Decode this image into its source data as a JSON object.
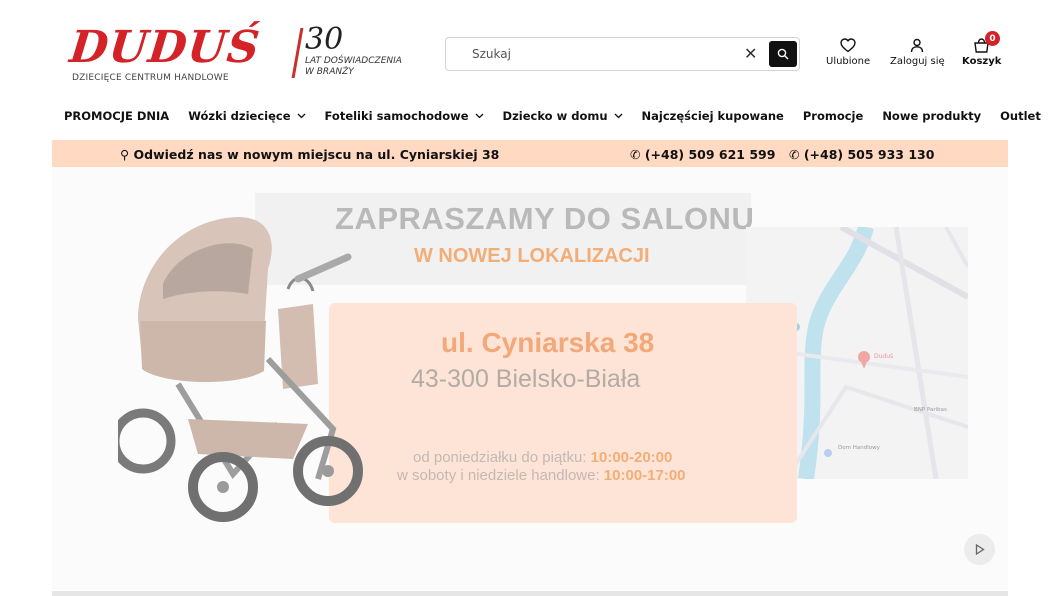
{
  "header": {
    "logo_text": "DUDUŚ",
    "logo_subtitle": "DZIECIĘCE CENTRUM HANDLOWE",
    "years_number": "30",
    "years_text_line1": "LAT DOŚWIADCZENIA",
    "years_text_line2": "W BRANŻY",
    "search_placeholder": "Szukaj",
    "favorites_label": "Ulubione",
    "login_label": "Zaloguj się",
    "cart_label": "Koszyk",
    "cart_count": "0"
  },
  "nav": {
    "items": [
      {
        "label": "PROMOCJE DNIA",
        "dropdown": false
      },
      {
        "label": "Wózki dziecięce",
        "dropdown": true
      },
      {
        "label": "Foteliki samochodowe",
        "dropdown": true
      },
      {
        "label": "Dziecko w domu",
        "dropdown": true
      },
      {
        "label": "Najczęściej kupowane",
        "dropdown": false
      },
      {
        "label": "Promocje",
        "dropdown": false
      },
      {
        "label": "Nowe produkty",
        "dropdown": false
      },
      {
        "label": "Outlet",
        "dropdown": false
      }
    ]
  },
  "infobar": {
    "address": "⚲ Odwiedź nas w nowym miejscu na ul. Cyniarskiej 38",
    "phone1": "✆ (+48) 509 621 599",
    "phone2": "✆ (+48) 505 933 130"
  },
  "slide": {
    "headline1": "ZAPRASZAMY DO SALONU",
    "headline2": "W NOWEJ LOKALIZACJI",
    "street": "ul. Cyniarska 38",
    "city": "43-300 Bielsko-Biała",
    "hours1_label": "od poniedziałku do piątku:",
    "hours1_value": "10:00-20:00",
    "hours2_label": "w soboty i niedziele handlowe:",
    "hours2_value": "10:00-17:00",
    "map_pin_label": "Duduś",
    "map_label1": "Dom Handlowy",
    "map_label2": "BNP Paribas"
  },
  "colors": {
    "brand_red": "#d32228",
    "info_bar": "#ffd9c2",
    "accent_orange": "#f0a060"
  }
}
